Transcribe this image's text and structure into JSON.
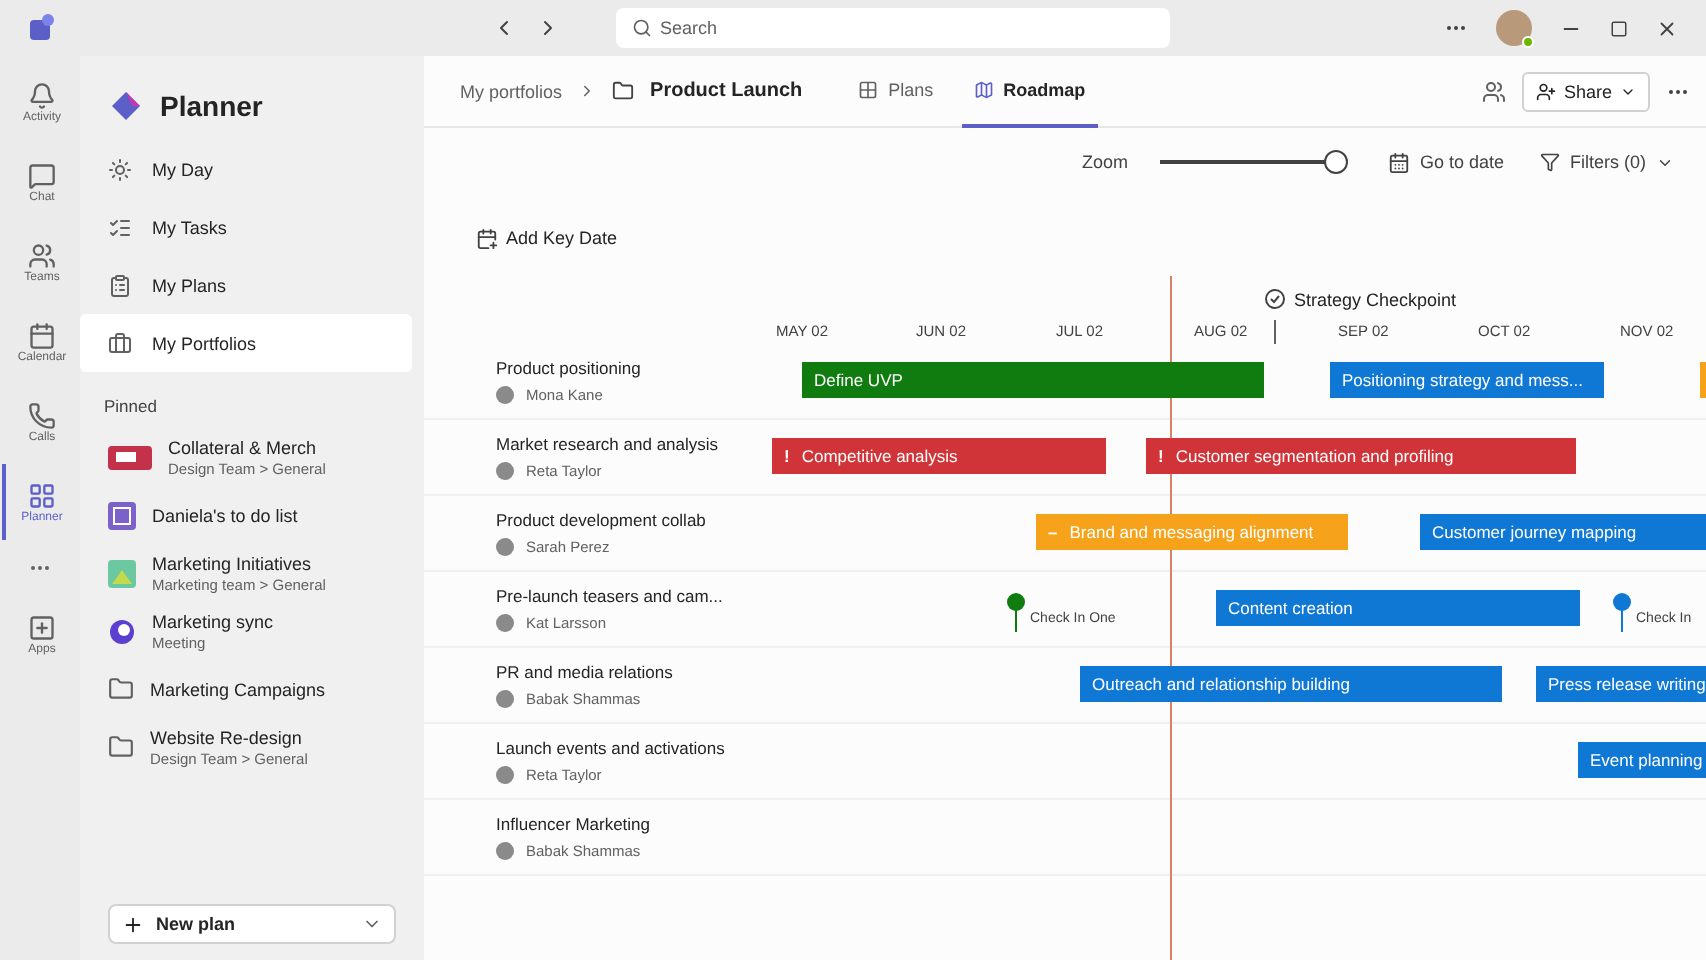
{
  "rail": {
    "items": [
      {
        "label": "Activity",
        "kind": "bell",
        "selected": false
      },
      {
        "label": "Chat",
        "kind": "chat",
        "selected": false
      },
      {
        "label": "Teams",
        "kind": "teams",
        "selected": false
      },
      {
        "label": "Calendar",
        "kind": "calendar",
        "selected": false
      },
      {
        "label": "Calls",
        "kind": "phone",
        "selected": false
      },
      {
        "label": "Planner",
        "kind": "planner",
        "selected": true
      },
      {
        "label": "Apps",
        "kind": "apps",
        "selected": false
      }
    ]
  },
  "titlebar": {
    "search": {
      "placeholder": "Search"
    }
  },
  "sidebar": {
    "title": "Planner",
    "nav": [
      {
        "label": "My Day",
        "kind": "sun",
        "selected": false
      },
      {
        "label": "My Tasks",
        "kind": "tasks",
        "selected": false
      },
      {
        "label": "My Plans",
        "kind": "plans",
        "selected": false
      },
      {
        "label": "My Portfolios",
        "kind": "portfolio",
        "selected": true
      }
    ],
    "section": "Pinned",
    "pinned": [
      {
        "name": "Collateral & Merch",
        "subtitle": "Design Team > General",
        "kind": "team"
      },
      {
        "name": "Daniela's to do list",
        "kind": "list"
      },
      {
        "name": "Marketing Initiatives",
        "subtitle": "Marketing team > General",
        "kind": "image"
      },
      {
        "name": "Marketing sync",
        "subtitle": "Meeting",
        "kind": "loop"
      },
      {
        "name": "Marketing Campaigns",
        "kind": "folder"
      },
      {
        "name": "Website Re-design",
        "subtitle": "Design Team > General",
        "kind": "folder"
      }
    ],
    "new_plan": "New plan"
  },
  "header": {
    "breadcrumb": "My portfolios",
    "title": "Product Launch",
    "tabs": [
      {
        "label": "Plans",
        "kind": "grid",
        "selected": false
      },
      {
        "label": "Roadmap",
        "kind": "roadmap",
        "selected": true
      }
    ],
    "share": "Share"
  },
  "toolbar": {
    "zoom": {
      "label": "Zoom",
      "level": 1
    },
    "go_to_date": "Go to date",
    "filters": "Filters (0)",
    "add_key_date": "Add Key Date"
  },
  "timeline": {
    "months": [
      "MAY 02",
      "JUN 02",
      "JUL 02",
      "AUG 02",
      "SEP 02",
      "OCT 02",
      "NOV 02"
    ],
    "key_date": "Strategy Checkpoint",
    "rows": [
      {
        "name": "Product positioning",
        "owner": "Mona Kane",
        "items": [
          {
            "kind": "bar",
            "label": "Define UVP",
            "color": "#107c10"
          },
          {
            "kind": "bar",
            "label": "Positioning strategy and mess...",
            "color": "#0f78d4"
          },
          {
            "kind": "bar",
            "color": "#f7a21b"
          }
        ]
      },
      {
        "name": "Market research and analysis",
        "owner": "Reta Taylor",
        "items": [
          {
            "kind": "bar",
            "label": "Competitive analysis",
            "prefix": "!",
            "color": "#d13438"
          },
          {
            "kind": "bar",
            "label": "Customer segmentation and profiling",
            "prefix": "!",
            "color": "#d13438"
          }
        ]
      },
      {
        "name": "Product development collab",
        "owner": "Sarah Perez",
        "items": [
          {
            "kind": "bar",
            "label": "Brand and messaging alignment",
            "prefix": "–",
            "color": "#f7a21b"
          },
          {
            "kind": "bar",
            "label": "Customer journey mapping",
            "color": "#0f78d4"
          }
        ]
      },
      {
        "name": "Pre-launch teasers and cam...",
        "owner": "Kat Larsson",
        "items": [
          {
            "kind": "milestone",
            "label": "Check In One",
            "color": "#107c10"
          },
          {
            "kind": "bar",
            "label": "Content creation",
            "color": "#0f78d4"
          },
          {
            "kind": "milestone",
            "label": "Check In",
            "color": "#0f78d4"
          }
        ]
      },
      {
        "name": "PR and media relations",
        "owner": "Babak Shammas",
        "items": [
          {
            "kind": "bar",
            "label": "Outreach and relationship building",
            "color": "#0f78d4"
          },
          {
            "kind": "bar",
            "label": "Press release writing",
            "color": "#0f78d4"
          }
        ]
      },
      {
        "name": "Launch events and activations",
        "owner": "Reta Taylor",
        "items": [
          {
            "kind": "bar",
            "label": "Event planning",
            "color": "#0f78d4"
          }
        ]
      },
      {
        "name": "Influencer Marketing",
        "owner": "Babak Shammas",
        "items": []
      }
    ]
  }
}
